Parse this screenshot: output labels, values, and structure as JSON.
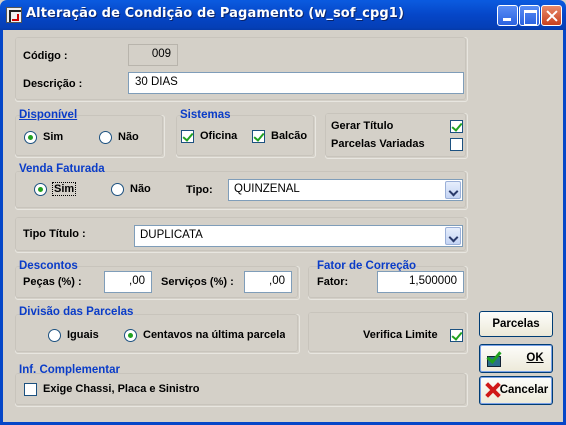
{
  "window": {
    "title": "Alteração de Condição de Pagamento (w_sof_cpg1)"
  },
  "codigo": {
    "label": "Código :",
    "value": "009"
  },
  "descricao": {
    "label": "Descrição :",
    "value": "30 DIAS"
  },
  "disponivel": {
    "header": "Disponível",
    "sim": "Sim",
    "nao": "Não",
    "selected": "Sim"
  },
  "sistemas": {
    "header": "Sistemas",
    "oficina": "Oficina",
    "balcao": "Balcão",
    "oficina_checked": true,
    "balcao_checked": true
  },
  "gerar": {
    "gerar_titulo": "Gerar Título",
    "parcelas_variadas": "Parcelas Variadas",
    "gerar_checked": true,
    "parcelas_checked": false
  },
  "venda_faturada": {
    "header": "Venda Faturada",
    "sim": "Sim",
    "nao": "Não",
    "selected": "Sim",
    "tipo_label": "Tipo:",
    "tipo_value": "QUINZENAL"
  },
  "tipo_titulo": {
    "label": "Tipo Título :",
    "value": "DUPLICATA"
  },
  "descontos": {
    "header": "Descontos",
    "pecas_label": "Peças (%) :",
    "pecas_value": ",00",
    "servicos_label": "Serviços (%) :",
    "servicos_value": ",00"
  },
  "fator": {
    "header": "Fator de Correção",
    "label": "Fator:",
    "value": "1,500000"
  },
  "divisao": {
    "header": "Divisão das Parcelas",
    "iguais": "Iguais",
    "centavos": "Centavos na última parcela",
    "selected": "Centavos na última parcela"
  },
  "verifica_limite": {
    "label": "Verifica Limite",
    "checked": true
  },
  "inf_complementar": {
    "header": "Inf. Complementar",
    "exige": "Exige Chassi, Placa e Sinistro",
    "checked": false
  },
  "buttons": {
    "parcelas": "Parcelas",
    "ok": "OK",
    "cancelar": "Cancelar"
  },
  "colors": {
    "accent": "#0a3cc8",
    "titlebar": "#0546c8",
    "check": "#21a121"
  }
}
